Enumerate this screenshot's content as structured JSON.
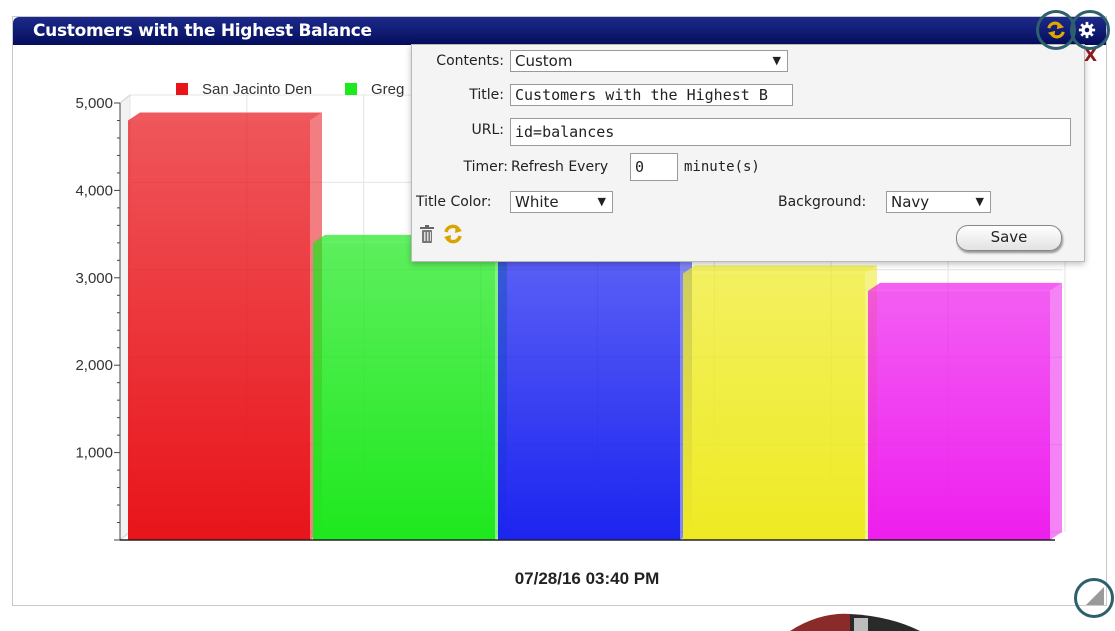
{
  "widget": {
    "title": "Customers with the Highest Balance",
    "timestamp": "07/28/16 03:40 PM",
    "close_label": "X"
  },
  "panel": {
    "contents_label": "Contents:",
    "contents_value": "Custom",
    "title_label": "Title:",
    "title_value": "Customers with the Highest B",
    "url_label": "URL:",
    "url_value": "id=balances",
    "timer_label": "Timer:",
    "timer_prefix": "Refresh Every",
    "timer_value": "0",
    "timer_suffix": "minute(s)",
    "title_color_label": "Title Color:",
    "title_color_value": "White",
    "background_label": "Background:",
    "background_value": "Navy",
    "save_label": "Save"
  },
  "icons": [
    "refresh-icon",
    "gear-icon",
    "trash-icon",
    "reload-icon",
    "resize-icon"
  ],
  "colors": {
    "title_bar": "#0b1566",
    "accent_ring": "#2d5f6d"
  },
  "chart_data": {
    "type": "bar",
    "title": "",
    "y_ticks": [
      "1,000",
      "2,000",
      "3,000",
      "4,000",
      "5,000"
    ],
    "ylim": [
      0,
      5000
    ],
    "legend_position": "top-left",
    "series": [
      {
        "name": "San Jacinto Den",
        "value": 4800,
        "color": "#e8141a"
      },
      {
        "name": "Greg",
        "value": 3400,
        "color": "#1ee81e"
      },
      {
        "name": "",
        "value": 3350,
        "color": "#1c24f0"
      },
      {
        "name": "",
        "value": 3050,
        "color": "#eeea22"
      },
      {
        "name": "",
        "value": 2850,
        "color": "#ee1eee"
      }
    ]
  }
}
